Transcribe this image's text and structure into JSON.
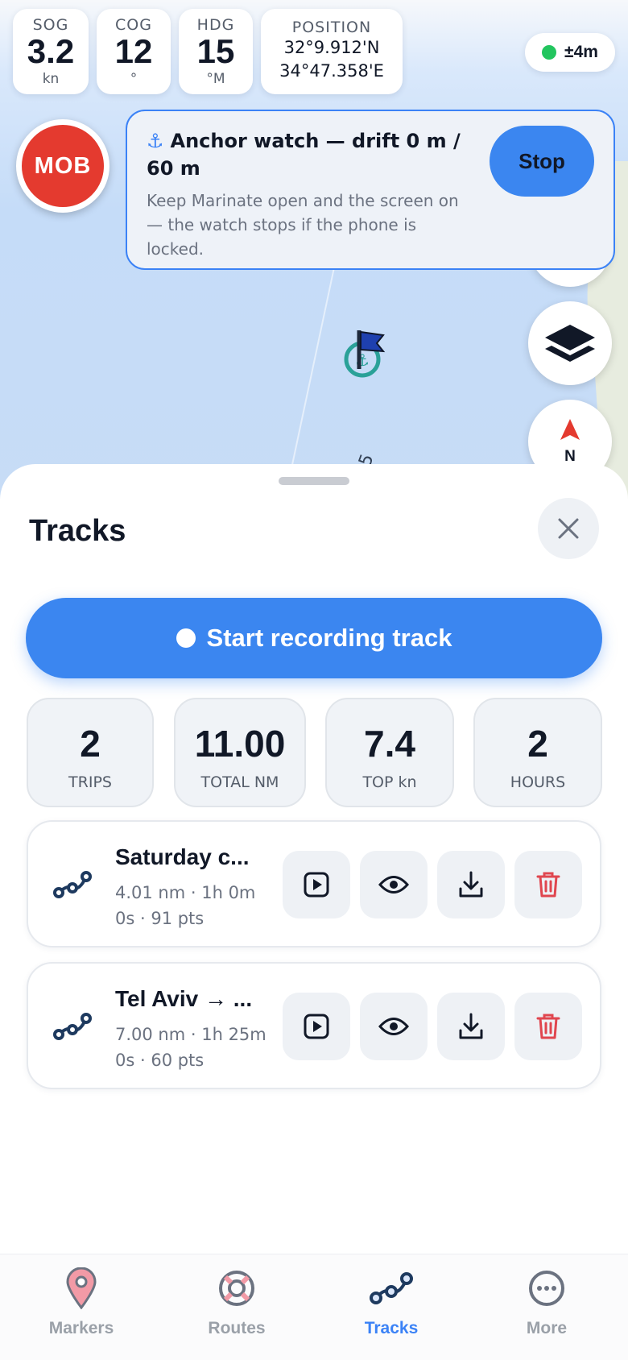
{
  "instruments": {
    "sog": {
      "label": "SOG",
      "value": "3.2",
      "unit": "kn"
    },
    "cog": {
      "label": "COG",
      "value": "12",
      "unit": "°"
    },
    "hdg": {
      "label": "HDG",
      "value": "15",
      "unit": "°M"
    },
    "position": {
      "label": "POSITION",
      "lat": "32°9.912'N",
      "lon": "34°47.358'E"
    }
  },
  "gps_accuracy": "±4m",
  "mob_label": "MOB",
  "anchor_watch": {
    "icon": "anchor-icon",
    "title": "Anchor watch — drift 0 m / 60 m",
    "subtitle": "Keep Marinate open and the screen on — the watch stops if the phone is locked.",
    "stop_label": "Stop"
  },
  "map": {
    "compass_label": "N",
    "marker_label": "5"
  },
  "sheet": {
    "title": "Tracks",
    "record_label": "Start recording track",
    "stats": [
      {
        "value": "2",
        "label": "TRIPS"
      },
      {
        "value": "11.00",
        "label": "TOTAL NM"
      },
      {
        "value": "7.4",
        "label": "TOP kn"
      },
      {
        "value": "2",
        "label": "HOURS"
      }
    ],
    "tracks": [
      {
        "name": "Saturday c...",
        "line1": "4.01 nm · 1h 0m",
        "line2": "0s · 91 pts"
      },
      {
        "name": "Tel Aviv → ...",
        "line1": "7.00 nm · 1h 25m",
        "line2": "0s · 60 pts"
      }
    ]
  },
  "nav": [
    {
      "label": "Markers",
      "icon": "pin-icon"
    },
    {
      "label": "Routes",
      "icon": "lifebuoy-icon"
    },
    {
      "label": "Tracks",
      "icon": "track-icon",
      "active": true
    },
    {
      "label": "More",
      "icon": "more-icon"
    }
  ],
  "colors": {
    "accent": "#3b86f0",
    "mob": "#e43a2f",
    "delete": "#e0464f",
    "gps_ok": "#22c55e"
  }
}
